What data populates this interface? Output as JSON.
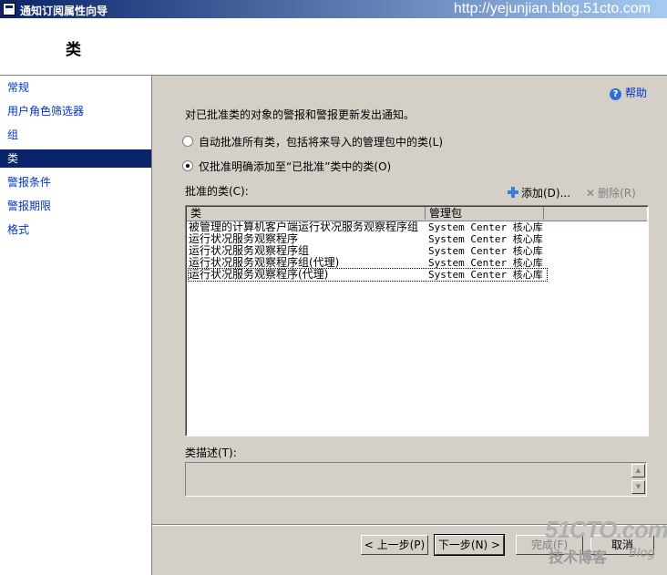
{
  "window": {
    "title": "通知订阅属性向导",
    "watermark": "http://yejunjian.blog.51cto.com"
  },
  "header": {
    "title": "类"
  },
  "nav": {
    "items": [
      "常规",
      "用户角色筛选器",
      "组",
      "类",
      "警报条件",
      "警报期限",
      "格式"
    ],
    "selected": "类"
  },
  "help": {
    "label": "帮助"
  },
  "content": {
    "description": "对已批准类的对象的警报和警报更新发出通知。",
    "radio_all": "自动批准所有类，包括将来导入的管理包中的类(L)",
    "radio_only": "仅批准明确添加至“已批准”类中的类(O)",
    "radio_selected": "radio_only",
    "approved_label": "批准的类(C):",
    "add_label": "添加(D)...",
    "delete_label": "删除(R)"
  },
  "table": {
    "columns": [
      "类",
      "管理包"
    ],
    "rows": [
      {
        "class": "被管理的计算机客户端运行状况服务观察程序组",
        "pack": "System Center 核心库"
      },
      {
        "class": "运行状况服务观察程序",
        "pack": "System Center 核心库"
      },
      {
        "class": "运行状况服务观察程序组",
        "pack": "System Center 核心库"
      },
      {
        "class": "运行状况服务观察程序组(代理)",
        "pack": "System Center 核心库"
      },
      {
        "class": "运行状况服务观察程序(代理)",
        "pack": "System Center 核心库"
      }
    ]
  },
  "class_desc": {
    "label": "类描述(T):",
    "value": ""
  },
  "buttons": {
    "back": "< 上一步(P)",
    "next": "下一步(N) >",
    "finish": "完成(F)",
    "cancel": "取消"
  },
  "logo": {
    "main": "51CTO.com",
    "sub": "技术博客",
    "blog": "Blog"
  },
  "icons": {
    "help": "help-icon",
    "add": "plus-icon",
    "delete": "x-icon",
    "title": "window-icon"
  }
}
